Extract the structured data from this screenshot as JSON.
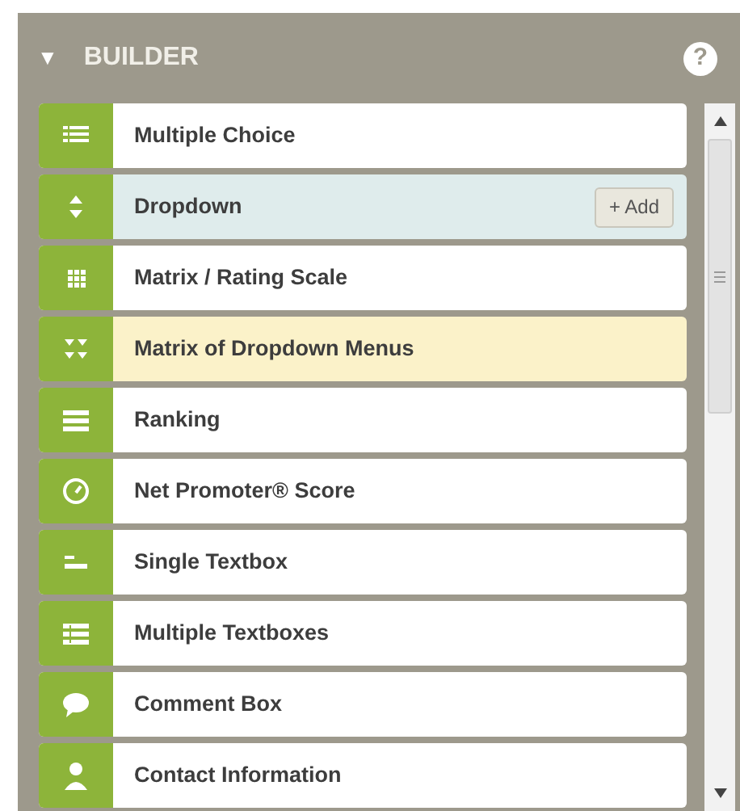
{
  "panel": {
    "toggle": "▼",
    "title": "BUILDER",
    "help": "?"
  },
  "items": [
    {
      "label": "Multiple Choice",
      "hovered": false,
      "highlighted": false
    },
    {
      "label": "Dropdown",
      "hovered": true,
      "highlighted": false,
      "action": "+ Add"
    },
    {
      "label": "Matrix / Rating Scale",
      "hovered": false,
      "highlighted": false
    },
    {
      "label": "Matrix of Dropdown Menus",
      "hovered": false,
      "highlighted": true
    },
    {
      "label": "Ranking",
      "hovered": false,
      "highlighted": false
    },
    {
      "label": "Net Promoter® Score",
      "hovered": false,
      "highlighted": false
    },
    {
      "label": "Single Textbox",
      "hovered": false,
      "highlighted": false
    },
    {
      "label": "Multiple Textboxes",
      "hovered": false,
      "highlighted": false
    },
    {
      "label": "Comment Box",
      "hovered": false,
      "highlighted": false
    },
    {
      "label": "Contact Information",
      "hovered": false,
      "highlighted": false
    }
  ]
}
